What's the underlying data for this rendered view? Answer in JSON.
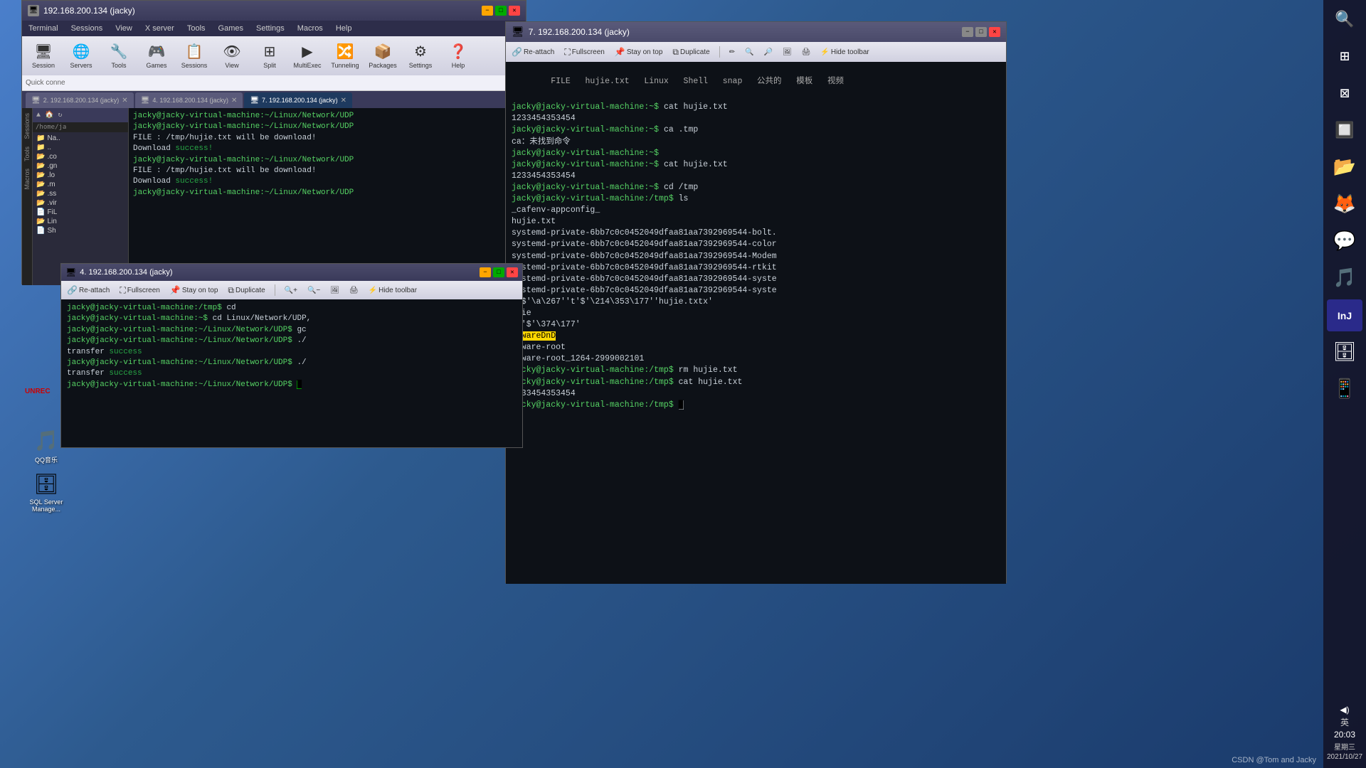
{
  "app": {
    "title": "192.168.200.134 (jacky)",
    "window4_title": "4. 192.168.200.134 (jacky)",
    "window7_title": "7. 192.168.200.134 (jacky)"
  },
  "menu": {
    "items": [
      "Terminal",
      "Sessions",
      "View",
      "X server",
      "Tools",
      "Games",
      "Settings",
      "Macros",
      "Help"
    ]
  },
  "toolbar": {
    "buttons": [
      "Session",
      "Servers",
      "Tools",
      "Games",
      "Sessions",
      "View",
      "Split",
      "MultiExec",
      "Tunneling",
      "Packages",
      "Settings",
      "Help"
    ]
  },
  "tabs": {
    "tab2": "2. 192.168.200.134 (jacky)",
    "tab4": "4. 192.168.200.134 (jacky)",
    "tab7": "7. 192.168.200.134 (jacky)"
  },
  "terminal_main": {
    "lines": [
      "jacky@jacky-virtual-machine:~/Linux/Network/UDP",
      "jacky@jacky-virtual-machine:~/Linux/Network/UDP",
      "FILE : /tmp/hujie.txt will be download!",
      "Download success!",
      "jacky@jacky-virtual-machine:~/Linux/Network/UDP",
      "FILE : /tmp/hujie.txt will be download!",
      "Download success!",
      "jacky@jacky-virtual-machine:~/Linux/Network/UDP"
    ]
  },
  "terminal4": {
    "lines": [
      "jacky@jacky-virtual-machine:/tmp$ cd",
      "jacky@jacky-virtual-machine:~$ cd Linux/Network/UDP",
      "jacky@jacky-virtual-machine:~/Linux/Network/UDP$ gc",
      "jacky@jacky-virtual-machine:~/Linux/Network/UDP$ ./",
      "transfer success",
      "jacky@jacky-virtual-machine:~/Linux/Network/UDP$ ./",
      "transfer success",
      "jacky@jacky-virtual-machine:~/Linux/Network/UDP$"
    ]
  },
  "terminal7": {
    "header": "FILE  hujie.txt  Linux  Shell  snap  公共的  模板  视频",
    "lines": [
      "jacky@jacky-virtual-machine:~$ cat hujie.txt",
      "1233454353454",
      "jacky@jacky-virtual-machine:~$ ca .tmp",
      "ca：未找到命令",
      "jacky@jacky-virtual-machine:~$",
      "jacky@jacky-virtual-machine:~$ cat hujie.txt",
      "1233454353454",
      "jacky@jacky-virtual-machine:~$ cd /tmp",
      "jacky@jacky-virtual-machine:/tmp$ ls",
      "_cafenv-appconfig_",
      "hujie.txt",
      "systemd-private-6bb7c0c0452049dfaa81aa7392969544-bolt.",
      "systemd-private-6bb7c0c0452049dfaa81aa7392969544-color",
      "systemd-private-6bb7c0c0452049dfaa81aa7392969544-Modem",
      "systemd-private-6bb7c0c0452049dfaa81aa7392969544-rtkit",
      "systemd-private-6bb7c0c0452049dfaa81aa7392969544-syste",
      "systemd-private-6bb7c0c0452049dfaa81aa7392969544-syste",
      "''$'\\a\\267''t'$'\\214\\353\\177''hujie.txtx'",
      "ujie",
      "'v'$'\\374\\177'",
      "VMwareDnD",
      "vmware-root",
      "vmware-root_1264-2999002101",
      "jacky@jacky-virtual-machine:/tmp$ rm hujie.txt",
      "jacky@jacky-virtual-machine:/tmp$ cat hujie.txt",
      "1233454353454",
      "jacky@jacky-virtual-machine:/tmp$"
    ]
  },
  "toolbar4": {
    "reattach": "Re-attach",
    "fullscreen": "Fullscreen",
    "stay_on_top": "Stay on top",
    "duplicate": "Duplicate",
    "hide_toolbar": "Hide toolbar"
  },
  "toolbar7": {
    "reattach": "Re-attach",
    "fullscreen": "Fullscreen",
    "stay_on_top": "Stay on top",
    "duplicate": "Duplicate",
    "hide_toolbar": "Hide toolbar"
  },
  "sidebar": {
    "path": "/home/ja",
    "items": [
      "Na..",
      "..",
      ".co",
      ".gn",
      ".lo",
      ".m",
      ".ss",
      ".vir",
      "FiL",
      "Lin",
      "Sh"
    ]
  },
  "left_tabs": [
    "Sessions",
    "Tools",
    "Macros"
  ],
  "right_sidebar": {
    "icons": [
      "🔍",
      "⊞",
      "⊠",
      "🔲",
      "📂",
      "🦊",
      "💬",
      "🎵",
      "🛢"
    ]
  },
  "clock": {
    "volume": "◀)",
    "input_method": "英",
    "time": "20:03",
    "day": "星期三",
    "date": "2021/10/27"
  },
  "watermark": "CSDN @Tom and Jacky",
  "quick_connect": "Quick conne",
  "vmware_highlight": "VMwareDnD"
}
